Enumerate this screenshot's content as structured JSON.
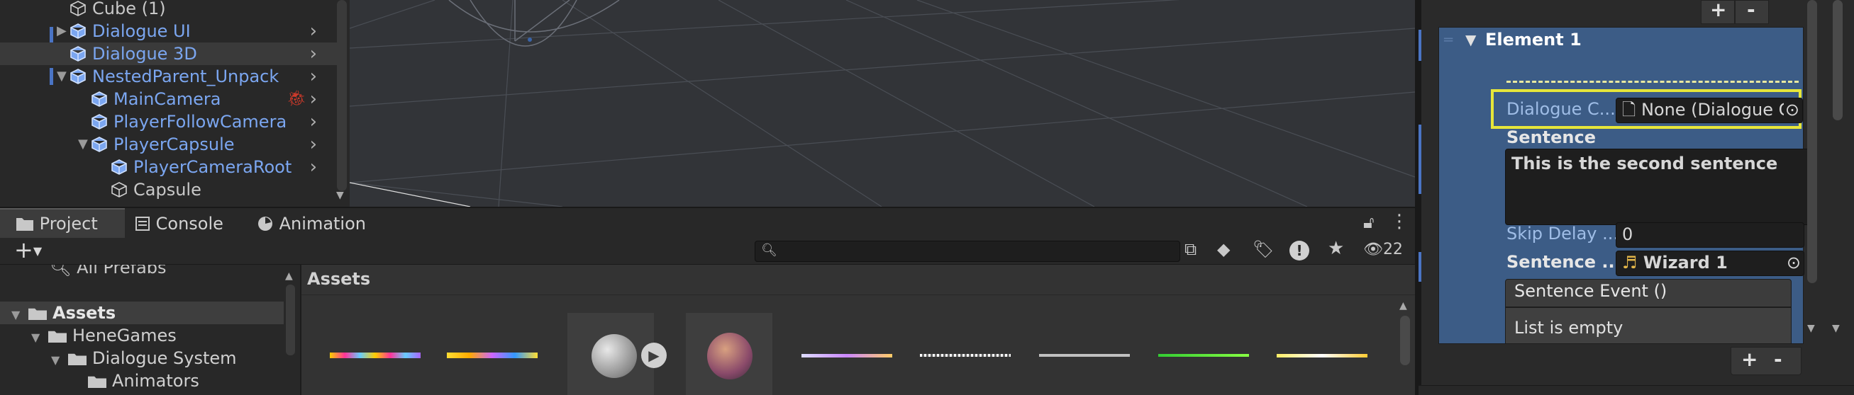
{
  "hierarchy": {
    "items": [
      {
        "label": "Cube (1)",
        "style": "white",
        "indent": 1
      },
      {
        "label": "Dialogue UI",
        "style": "blue",
        "indent": 1,
        "collapsed": true
      },
      {
        "label": "Dialogue 3D",
        "style": "blue",
        "indent": 1,
        "selected": true
      },
      {
        "label": "NestedParent_Unpack",
        "style": "blue",
        "indent": 1,
        "expanded": true
      },
      {
        "label": "MainCamera",
        "style": "blue",
        "indent": 2
      },
      {
        "label": "PlayerFollowCamera",
        "style": "blue",
        "indent": 2
      },
      {
        "label": "PlayerCapsule",
        "style": "blue",
        "indent": 2,
        "expanded": true
      },
      {
        "label": "PlayerCameraRoot",
        "style": "blue",
        "indent": 3
      },
      {
        "label": "Capsule",
        "style": "white",
        "indent": 3
      }
    ]
  },
  "bottom_tabs": [
    {
      "label": "Project",
      "icon": "folder-icon"
    },
    {
      "label": "Console",
      "icon": "console-icon"
    },
    {
      "label": "Animation",
      "icon": "animation-icon"
    }
  ],
  "toolbar": {
    "add_label": "+",
    "search_value": "",
    "hidden_count": "22"
  },
  "project_tree": {
    "search_item": "All Prefabs",
    "items": [
      {
        "label": "Assets",
        "indent": 0
      },
      {
        "label": "HeneGames",
        "indent": 1
      },
      {
        "label": "Dialogue System",
        "indent": 2
      },
      {
        "label": "Animators",
        "indent": 3
      }
    ]
  },
  "assets_panel": {
    "title": "Assets"
  },
  "inspector": {
    "element_title": "Element 1",
    "dialogue_label": "Dialogue C...",
    "dialogue_value": "None (Dialogue C",
    "sentence_label": "Sentence",
    "sentence_value": "This is the second sentence",
    "skip_label": "Skip Delay ...",
    "skip_value": "0",
    "sentence_audio_label": "Sentence ...",
    "sentence_audio_value": "Wizard 1",
    "event_title": "Sentence Event ()",
    "event_empty": "List is empty",
    "plus": "+",
    "minus": "-"
  },
  "colors": {
    "highlight": "#e6e63a",
    "selection_blue": "#3e5f8a",
    "prefab_blue": "#7ba6f0"
  }
}
